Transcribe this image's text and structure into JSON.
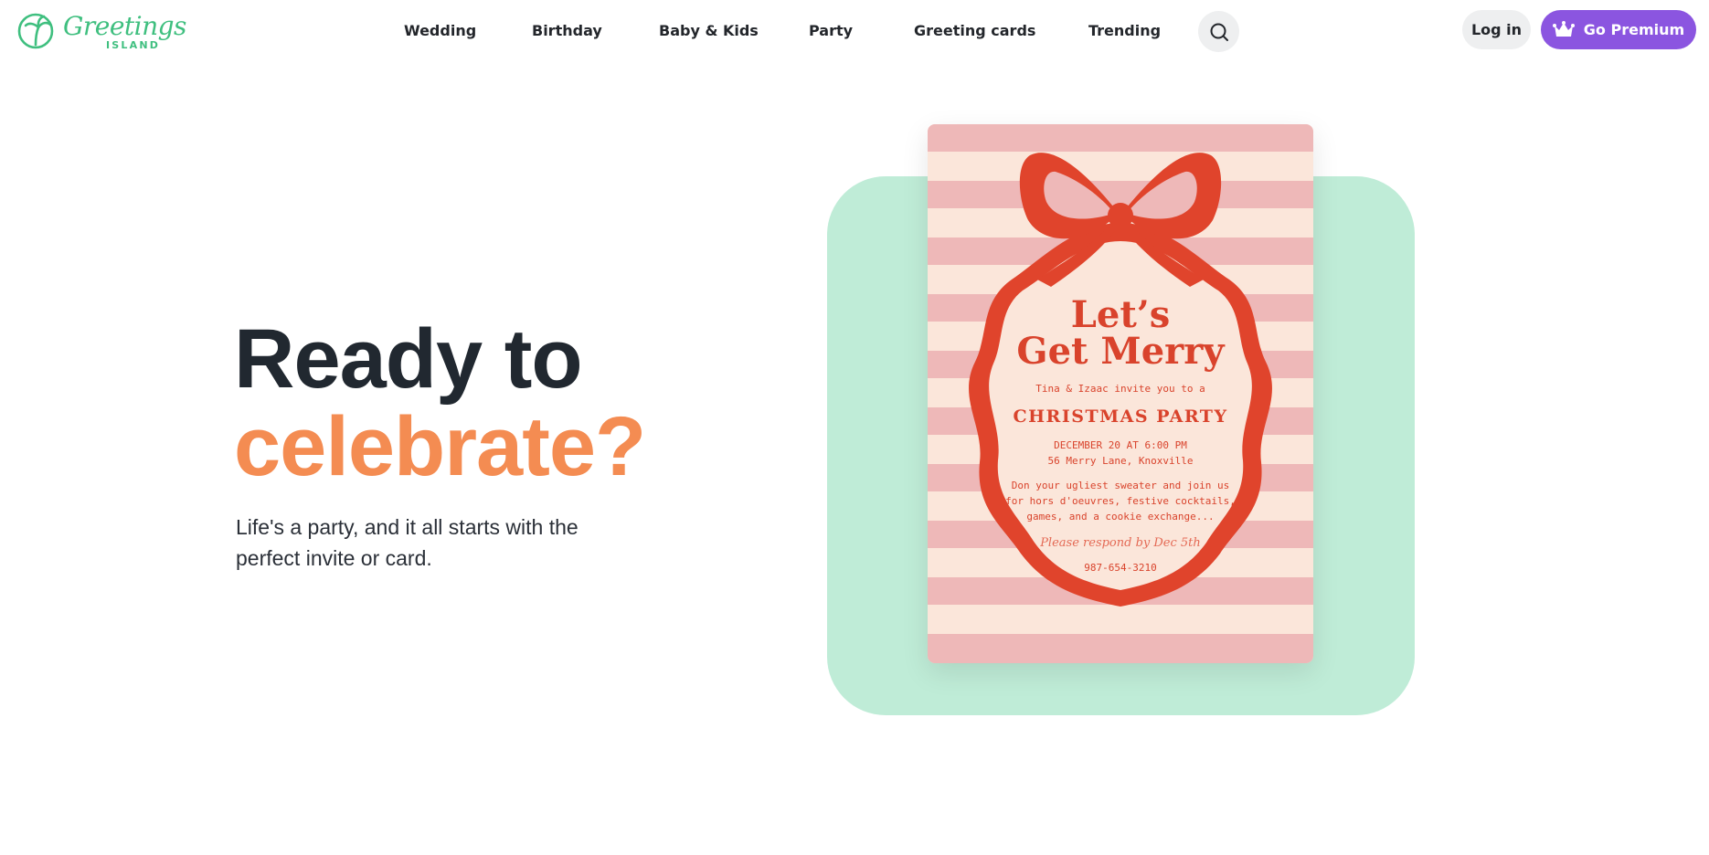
{
  "brand": {
    "logo_script": "Greetings",
    "logo_sub": "ISLAND",
    "logo_icon": "palm-tree-icon",
    "color": "#3fbf7f"
  },
  "nav": {
    "items": [
      {
        "label": "Wedding"
      },
      {
        "label": "Birthday"
      },
      {
        "label": "Baby & Kids"
      },
      {
        "label": "Party"
      },
      {
        "label": "Greeting cards"
      },
      {
        "label": "Trending"
      }
    ],
    "search_icon": "search-icon"
  },
  "account": {
    "login_label": "Log in",
    "premium_label": "Go Premium",
    "premium_icon": "crown-icon",
    "premium_color": "#8b55e0"
  },
  "hero": {
    "title_line1": "Ready to",
    "title_line2": "celebrate?",
    "subtitle": "Life's a party, and it all starts with the perfect invite or card.",
    "accent_color": "#f48c52"
  },
  "card": {
    "headline_line1": "Let’s",
    "headline_line2": "Get Merry",
    "invite_line": "Tina & Izaac invite you to a",
    "event_name": "CHRISTMAS PARTY",
    "date_line": "DECEMBER 20 AT 6:00 PM",
    "address_line": "56 Merry Lane, Knoxville",
    "details_line1": "Don your ugliest sweater and join us",
    "details_line2": "for hors d'oeuvres, festive cocktails,",
    "details_line3": "games, and a cookie exchange...",
    "rsvp_line": "Please respond by Dec 5th",
    "phone_line": "987-654-3210",
    "ribbon_color": "#e0442c",
    "stripe_color": "#eeb8b8",
    "cream_color": "#fbe6da"
  }
}
